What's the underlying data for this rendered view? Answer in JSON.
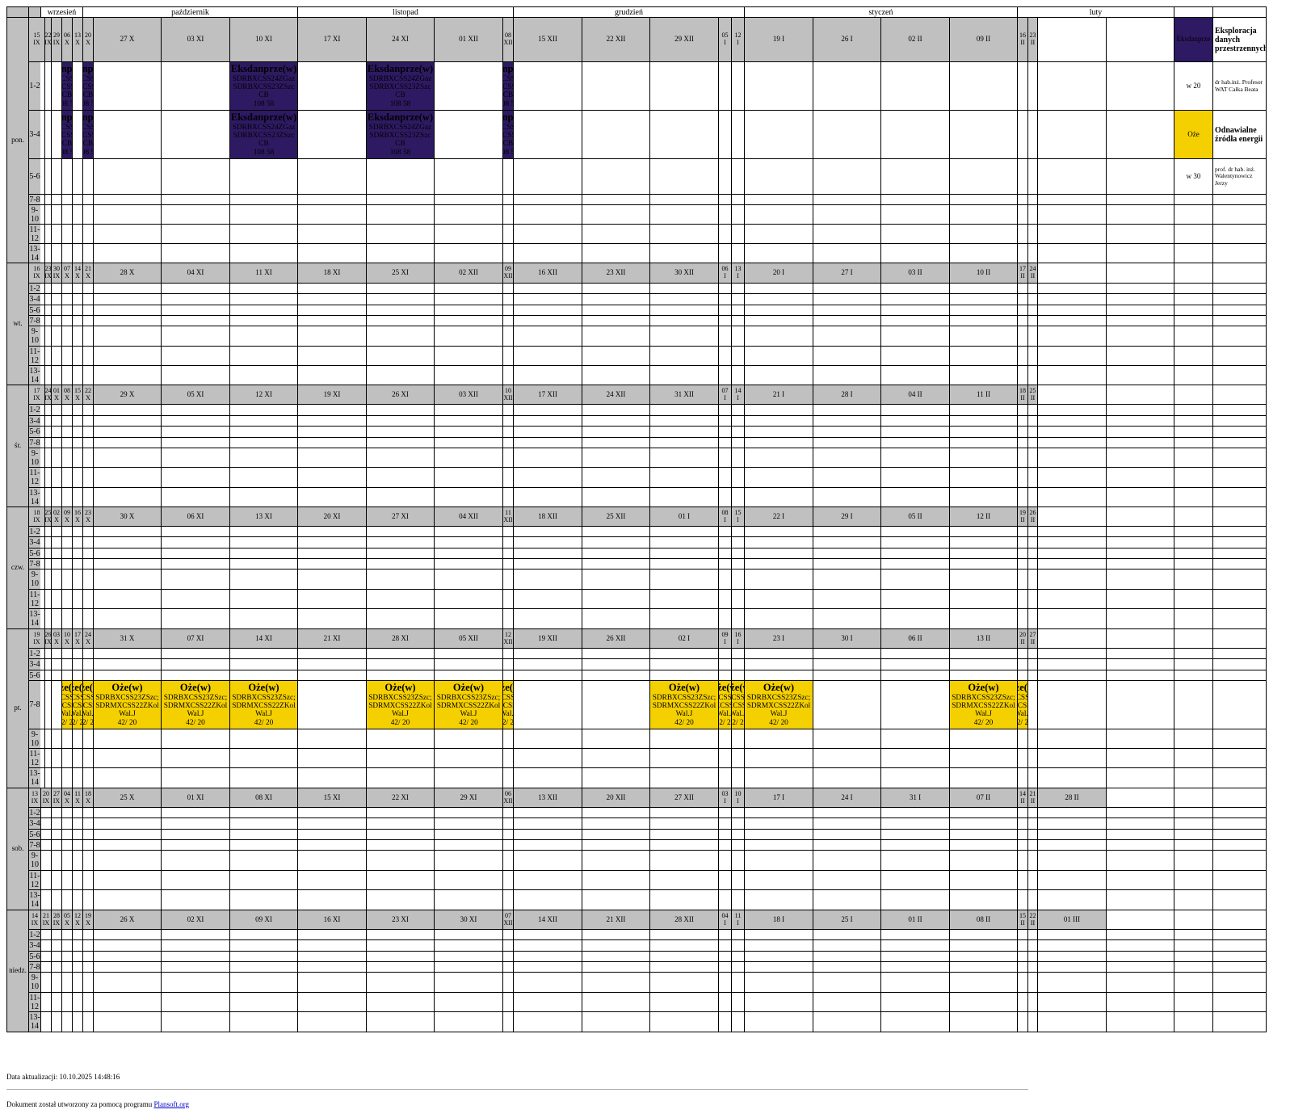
{
  "months": [
    "wrzesień",
    "październik",
    "listopad",
    "grudzień",
    "styczeń",
    "luty"
  ],
  "slots": [
    "1-2",
    "3-4",
    "5-6",
    "7-8",
    "9-10",
    "11-12",
    "13-14"
  ],
  "days": [
    {
      "label": "pon.",
      "dates": [
        "15 IX",
        "22 IX",
        "29 IX",
        "06 X",
        "13 X",
        "20 X",
        "27 X",
        "03 XI",
        "10 XI",
        "17 XI",
        "24 XI",
        "01 XII",
        "08 XII",
        "15 XII",
        "22 XII",
        "29 XII",
        "05 I",
        "12 I",
        "19 I",
        "26 I",
        "02 II",
        "09 II",
        "16 II",
        "23 II"
      ]
    },
    {
      "label": "wt.",
      "dates": [
        "16 IX",
        "23 IX",
        "30 IX",
        "07 X",
        "14 X",
        "21 X",
        "28 X",
        "04 XI",
        "11 XI",
        "18 XI",
        "25 XI",
        "02 XII",
        "09 XII",
        "16 XII",
        "23 XII",
        "30 XII",
        "06 I",
        "13 I",
        "20 I",
        "27 I",
        "03 II",
        "10 II",
        "17 II",
        "24 II"
      ]
    },
    {
      "label": "śr.",
      "dates": [
        "17 IX",
        "24 IX",
        "01 X",
        "08 X",
        "15 X",
        "22 X",
        "29 X",
        "05 XI",
        "12 XI",
        "19 XI",
        "26 XI",
        "03 XII",
        "10 XII",
        "17 XII",
        "24 XII",
        "31 XII",
        "07 I",
        "14 I",
        "21 I",
        "28 I",
        "04 II",
        "11 II",
        "18 II",
        "25 II"
      ]
    },
    {
      "label": "czw.",
      "dates": [
        "18 IX",
        "25 IX",
        "02 X",
        "09 X",
        "16 X",
        "23 X",
        "30 X",
        "06 XI",
        "13 XI",
        "20 XI",
        "27 XI",
        "04 XII",
        "11 XII",
        "18 XII",
        "25 XII",
        "01 I",
        "08 I",
        "15 I",
        "22 I",
        "29 I",
        "05 II",
        "12 II",
        "19 II",
        "26 II"
      ]
    },
    {
      "label": "pt.",
      "dates": [
        "19 IX",
        "26 IX",
        "03 X",
        "10 X",
        "17 X",
        "24 X",
        "31 X",
        "07 XI",
        "14 XI",
        "21 XI",
        "28 XI",
        "05 XII",
        "12 XII",
        "19 XII",
        "26 XII",
        "02 I",
        "09 I",
        "16 I",
        "23 I",
        "30 I",
        "06 II",
        "13 II",
        "20 II",
        "27 II"
      ]
    },
    {
      "label": "sob.",
      "dates": [
        "13 IX",
        "20 IX",
        "27 IX",
        "04 X",
        "11 X",
        "18 X",
        "25 X",
        "01 XI",
        "08 XI",
        "15 XI",
        "22 XI",
        "29 XI",
        "06 XII",
        "13 XII",
        "20 XII",
        "27 XII",
        "03 I",
        "10 I",
        "17 I",
        "24 I",
        "31 I",
        "07 II",
        "14 II",
        "21 II",
        "28 II"
      ]
    },
    {
      "label": "niedz.",
      "dates": [
        "14 IX",
        "21 IX",
        "28 IX",
        "05 X",
        "12 X",
        "19 X",
        "26 X",
        "02 XI",
        "09 XI",
        "16 XI",
        "23 XI",
        "30 XI",
        "07 XII",
        "14 XII",
        "21 XII",
        "28 XII",
        "04 I",
        "11 I",
        "18 I",
        "25 I",
        "01 II",
        "08 II",
        "15 II",
        "22 II",
        "01 III"
      ]
    }
  ],
  "event_types": {
    "ek": {
      "title": "Eksdanprze(w)",
      "lines": [
        "SDRBXCSS24ZGaz",
        "SDRBXCSS23ZSzc",
        "CB",
        "108 58"
      ],
      "color": "#2e1a63"
    },
    "oz1": {
      "title": "Oże(w)",
      "lines": [
        "SDRBXCSS23ZSzc;",
        "SDRMXCSS22ZKol",
        "Wal.J",
        "42/ 20"
      ],
      "color": "#f5d000"
    },
    "oz2": {
      "title": "Oże(w)",
      "lines": [
        "SDRBXCSS23ZSzc;",
        "SDRMXCSS22ZKol",
        "Wal.J",
        "42/ 20"
      ],
      "color": "#f5d000"
    }
  },
  "legend": [
    {
      "short": "Eksdanprze",
      "name": "Eksploracja danych przestrzennych",
      "hours": "w 20",
      "teacher": "dr hab.inż. Profesor WAT Całka Beata",
      "color": "#2e1a63"
    },
    {
      "short": "Oże",
      "name": "Odnawialne źródła energii",
      "hours": "w 30",
      "teacher": "prof. dr hab. inż. Walentynowicz Jerzy",
      "color": "#f5d000"
    }
  ],
  "footer": {
    "update_text": "Data aktualizacji: 10.10.2025 14:48:16",
    "generated_prefix": "Dokument został utworzony za pomocą programu ",
    "generated_link": "Plansoft.org"
  }
}
